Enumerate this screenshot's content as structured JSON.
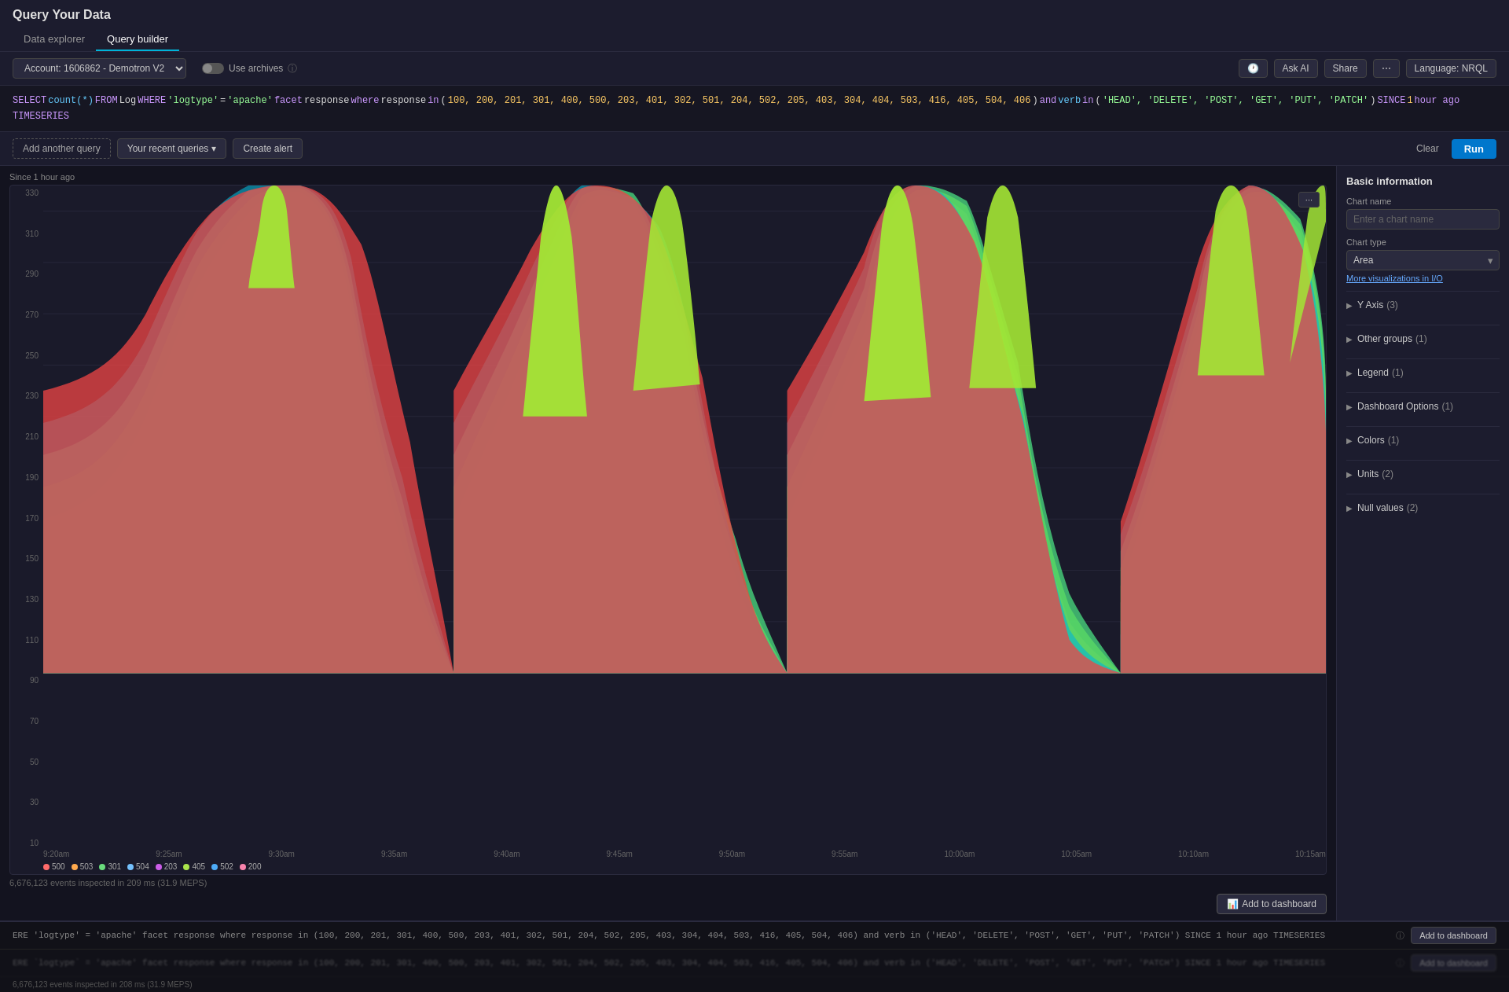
{
  "app": {
    "title": "Query Your Data"
  },
  "tabs": [
    {
      "id": "data-explorer",
      "label": "Data explorer",
      "active": false
    },
    {
      "id": "query-builder",
      "label": "Query builder",
      "active": true
    }
  ],
  "toolbar": {
    "account_label": "Account: 1606862 - Demotron V2",
    "use_archives_label": "Use archives",
    "ask_ai_label": "Ask AI",
    "share_label": "Share",
    "language_label": "Language: NRQL"
  },
  "query": {
    "text": "SELECT count(*) FROM Log WHERE 'logtype' = 'apache' facet response where response in (100, 200, 201, 301, 400, 500, 203, 401, 302, 501, 204, 502, 205, 403, 304, 404, 503, 416, 405, 504, 406) and verb in ('HEAD', 'DELETE', 'POST', 'GET', 'PUT', 'PATCH') SINCE 1 hour ago TIMESERIES"
  },
  "query_actions": {
    "add_another_label": "Add another query",
    "recent_queries_label": "Your recent queries",
    "create_alert_label": "Create alert",
    "clear_label": "Clear",
    "run_label": "Run"
  },
  "chart": {
    "since_label": "Since 1 hour ago",
    "options_btn": "···",
    "y_axis_labels": [
      "330",
      "310",
      "290",
      "270",
      "250",
      "230",
      "210",
      "190",
      "170",
      "150",
      "130",
      "110",
      "90",
      "70",
      "50",
      "30",
      "10"
    ],
    "x_axis_labels": [
      "9:20am",
      "9:25am",
      "9:30am",
      "9:35am",
      "9:40am",
      "9:45am",
      "9:50am",
      "9:55am",
      "10:00am",
      "10:05am",
      "10:10am",
      "10:15am"
    ],
    "legend": [
      {
        "code": "500",
        "color": "#ff6b6b"
      },
      {
        "code": "503",
        "color": "#ffa94d"
      },
      {
        "code": "301",
        "color": "#69db7c"
      },
      {
        "code": "504",
        "color": "#74c0fc"
      },
      {
        "code": "203",
        "color": "#cc5de8"
      },
      {
        "code": "405",
        "color": "#a9e34b"
      },
      {
        "code": "502",
        "color": "#4dabf7"
      },
      {
        "code": "200",
        "color": "#f783ac"
      }
    ],
    "colors": [
      "#a9e34b",
      "#69db7c",
      "#ff6b6b",
      "#ffa94d",
      "#cc5de8",
      "#3bc9db",
      "#f783ac",
      "#74c0fc",
      "#4dabf7",
      "#e8590c",
      "#40c057",
      "#7950f2"
    ],
    "stats_label": "6,676,123 events inspected in 209 ms (31.9 MEPS)"
  },
  "right_panel": {
    "title": "Basic information",
    "chart_name_label": "Chart name",
    "chart_name_placeholder": "Enter a chart name",
    "chart_type_label": "Chart type",
    "chart_type_value": "Area",
    "more_viz_label": "More visualizations in I/O",
    "sections": [
      {
        "id": "y-axis",
        "label": "Y Axis",
        "badge": "(3)"
      },
      {
        "id": "other-groups",
        "label": "Other groups",
        "badge": "(1)"
      },
      {
        "id": "legend",
        "label": "Legend",
        "badge": "(1)"
      },
      {
        "id": "dashboard-options",
        "label": "Dashboard Options",
        "badge": "(1)"
      },
      {
        "id": "colors",
        "label": "Colors",
        "badge": "(1)"
      },
      {
        "id": "units",
        "label": "Units",
        "badge": "(2)"
      },
      {
        "id": "null-values",
        "label": "Null values",
        "badge": "(2)"
      }
    ]
  },
  "add_to_dashboard": {
    "label": "Add to dashboard"
  },
  "bottom_queries": [
    {
      "text": "ERE 'logtype' = 'apache' facet response where response in (100, 200, 201, 301, 400, 500, 203, 401, 302, 501, 204, 502, 205, 403, 304, 404, 503, 416, 405, 504, 406) and verb in ('HEAD', 'DELETE', 'POST', 'GET', 'PUT', 'PATCH') SINCE 1 hour ago TIMESERIES",
      "add_btn": "Add to dashboard"
    },
    {
      "text": "ERE `logtype` = 'apache' facet response where response in (100, 200, 201, 301, 400, 500, 203, 401, 302, 501, 204, 502, 205, 403, 304, 404, 503, 416, 405, 504, 406) and verb in ('HEAD', 'DELETE', 'POST', 'GET', 'PUT', 'PATCH') SINCE 1 hour ago TIMESERIES",
      "add_btn": "Add to dashboard"
    }
  ],
  "bottom_stats": "6,676,123 events inspected in 208 ms (31.9 MEPS)"
}
